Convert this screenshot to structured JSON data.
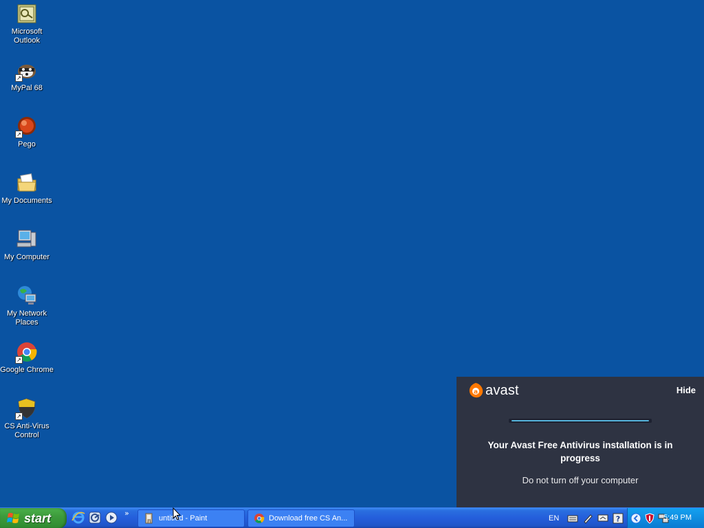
{
  "desktop": {
    "icons": [
      {
        "label": "Microsoft Outlook",
        "icon": "outlook-icon"
      },
      {
        "label": "MyPal 68",
        "icon": "mypal-icon"
      },
      {
        "label": "Pego",
        "icon": "pego-icon"
      },
      {
        "label": "My Documents",
        "icon": "documents-folder-icon"
      },
      {
        "label": "My Computer",
        "icon": "computer-icon"
      },
      {
        "label": "My Network Places",
        "icon": "network-icon"
      },
      {
        "label": "Google Chrome",
        "icon": "chrome-icon"
      },
      {
        "label": "CS Anti-Virus Control",
        "icon": "shield-icon"
      }
    ]
  },
  "avast_popup": {
    "brand": "avast",
    "hide_label": "Hide",
    "title": "Your Avast Free Antivirus installation is in progress",
    "subtitle": "Do not turn off your computer",
    "progress": 1.0,
    "accent_color": "#ff7800",
    "background_color": "#2e3342"
  },
  "taskbar": {
    "start_label": "start",
    "quicklaunch": [
      "internet-explorer-icon",
      "browser-icon",
      "media-player-icon"
    ],
    "chevron": "»",
    "tasks": [
      {
        "label": "untitled - Paint",
        "icon": "paint-icon"
      },
      {
        "label": "Download free CS An...",
        "icon": "chrome-icon"
      }
    ],
    "tray": {
      "language": "EN",
      "icons": [
        "keyboard-icon",
        "pen-icon",
        "monitor-icon",
        "help-icon",
        "chevron-left-icon",
        "avast-shield-icon",
        "network-icon"
      ],
      "clock": "5:49 PM"
    }
  }
}
